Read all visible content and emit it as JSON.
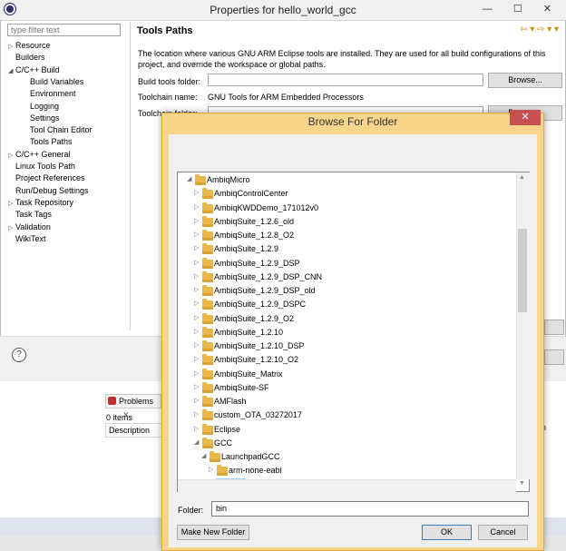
{
  "window": {
    "title": "Properties for hello_world_gcc",
    "controls": "— ☐ ✕"
  },
  "sidebar": {
    "filter_placeholder": "type filter text",
    "items": [
      {
        "label": "Resource",
        "twisty": "▷",
        "indent": 0
      },
      {
        "label": "Builders",
        "twisty": "",
        "indent": 0
      },
      {
        "label": "C/C++ Build",
        "twisty": "◢",
        "indent": 0
      },
      {
        "label": "Build Variables",
        "twisty": "",
        "indent": 1
      },
      {
        "label": "Environment",
        "twisty": "",
        "indent": 1
      },
      {
        "label": "Logging",
        "twisty": "",
        "indent": 1
      },
      {
        "label": "Settings",
        "twisty": "",
        "indent": 1
      },
      {
        "label": "Tool Chain Editor",
        "twisty": "",
        "indent": 1
      },
      {
        "label": "Tools Paths",
        "twisty": "",
        "indent": 1
      },
      {
        "label": "C/C++ General",
        "twisty": "▷",
        "indent": 0
      },
      {
        "label": "Linux Tools Path",
        "twisty": "",
        "indent": 0
      },
      {
        "label": "Project References",
        "twisty": "",
        "indent": 0
      },
      {
        "label": "Run/Debug Settings",
        "twisty": "",
        "indent": 0
      },
      {
        "label": "Task Repository",
        "twisty": "▷",
        "indent": 0
      },
      {
        "label": "Task Tags",
        "twisty": "",
        "indent": 0
      },
      {
        "label": "Validation",
        "twisty": "▷",
        "indent": 0
      },
      {
        "label": "WikiText",
        "twisty": "",
        "indent": 0
      }
    ]
  },
  "page": {
    "title": "Tools Paths",
    "nav": "⇦ ▾ ⇨ ▾ ▾",
    "description": "The location where various GNU ARM Eclipse tools are installed. They are used for all build configurations of this project, and override the workspace or global paths.",
    "build_tools_label": "Build tools folder:",
    "toolchain_name_label": "Toolchain name:",
    "toolchain_name_value": "GNU Tools for ARM Embedded Processors",
    "toolchain_folder_label": "Toolchain folder:",
    "browse_label": "Browse...",
    "help": "?"
  },
  "problems": {
    "tab": "Problems",
    "tab_close": "✕",
    "count": "0 items",
    "col_description": "Description",
    "col_trailing": "on"
  },
  "dialog": {
    "title": "Browse For Folder",
    "close": "✕",
    "folders": [
      {
        "label": "AmbiqMicro",
        "level": 0,
        "expander": "◢"
      },
      {
        "label": "AmbiqControlCenter",
        "level": 1,
        "expander": "▷"
      },
      {
        "label": "AmbiqKWDDemo_171012v0",
        "level": 1,
        "expander": "▷"
      },
      {
        "label": "AmbiqSuite_1.2.6_old",
        "level": 1,
        "expander": "▷"
      },
      {
        "label": "AmbiqSuite_1.2.8_O2",
        "level": 1,
        "expander": "▷"
      },
      {
        "label": "AmbiqSuite_1.2.9",
        "level": 1,
        "expander": "▷"
      },
      {
        "label": "AmbiqSuite_1.2.9_DSP",
        "level": 1,
        "expander": "▷"
      },
      {
        "label": "AmbiqSuite_1.2.9_DSP_CNN",
        "level": 1,
        "expander": "▷"
      },
      {
        "label": "AmbiqSuite_1.2.9_DSP_old",
        "level": 1,
        "expander": "▷"
      },
      {
        "label": "AmbiqSuite_1.2.9_DSPC",
        "level": 1,
        "expander": "▷"
      },
      {
        "label": "AmbiqSuite_1.2.9_O2",
        "level": 1,
        "expander": "▷"
      },
      {
        "label": "AmbiqSuite_1.2.10",
        "level": 1,
        "expander": "▷"
      },
      {
        "label": "AmbiqSuite_1.2.10_DSP",
        "level": 1,
        "expander": "▷"
      },
      {
        "label": "AmbiqSuite_1.2.10_O2",
        "level": 1,
        "expander": "▷"
      },
      {
        "label": "AmbiqSuite_Matrix",
        "level": 1,
        "expander": "▷"
      },
      {
        "label": "AmbiqSuite-SF",
        "level": 1,
        "expander": "▷"
      },
      {
        "label": "AMFlash",
        "level": 1,
        "expander": "▷"
      },
      {
        "label": "custom_OTA_03272017",
        "level": 1,
        "expander": "▷"
      },
      {
        "label": "Eclipse",
        "level": 1,
        "expander": "▷"
      },
      {
        "label": "GCC",
        "level": 1,
        "expander": "◢"
      },
      {
        "label": "LaunchpadGCC",
        "level": 2,
        "expander": "◢"
      },
      {
        "label": "arm-none-eabi",
        "level": 3,
        "expander": "▷"
      },
      {
        "label": "bin",
        "level": 3,
        "expander": "",
        "selected": true
      }
    ],
    "folder_label": "Folder:",
    "folder_value": "bin",
    "make_new_folder": "Make New Folder",
    "ok": "OK",
    "cancel": "Cancel"
  }
}
